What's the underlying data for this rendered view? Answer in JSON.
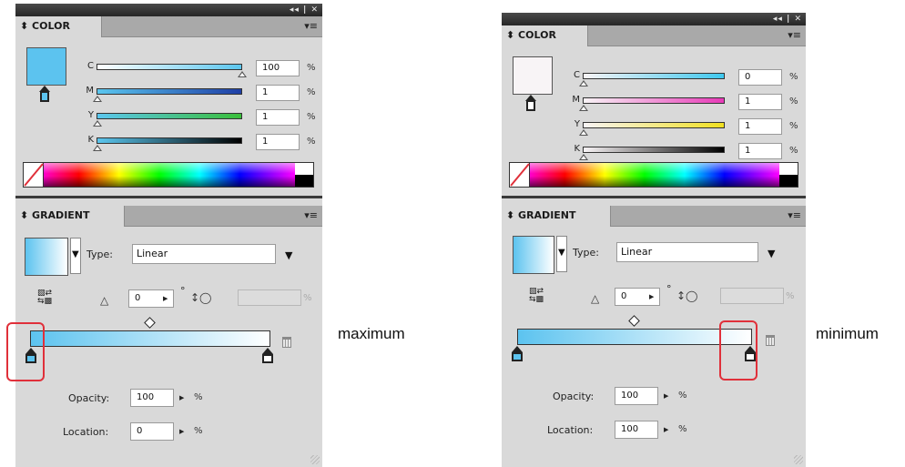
{
  "panels": [
    {
      "id": "left",
      "window_controls": "◂◂ | ✕",
      "color": {
        "tab": "⬍ COLOR",
        "swatch_color": "#5cc3ef",
        "channels": [
          {
            "label": "C",
            "value": "100",
            "unit": "%",
            "level": 1.0,
            "gradient": [
              "#ffffff",
              "#5bc6ee"
            ]
          },
          {
            "label": "M",
            "value": "1",
            "unit": "%",
            "level": 0.01,
            "gradient": [
              "#5bc6ee",
              "#1f3fa6"
            ]
          },
          {
            "label": "Y",
            "value": "1",
            "unit": "%",
            "level": 0.01,
            "gradient": [
              "#5bc6ee",
              "#3abf3a"
            ]
          },
          {
            "label": "K",
            "value": "1",
            "unit": "%",
            "level": 0.01,
            "gradient": [
              "#5bc6ee",
              "#000000"
            ]
          }
        ]
      },
      "gradient": {
        "tab": "⬍ GRADIENT",
        "type_label": "Type:",
        "type_value": "Linear",
        "angle_value": "0",
        "degree_symbol": "°",
        "percent_symbol": "%",
        "opacity_label": "Opacity:",
        "opacity_value": "100",
        "opacity_unit": "%",
        "location_label": "Location:",
        "location_value": "0",
        "location_unit": "%",
        "selected_stop": "left"
      },
      "caption": "maximum"
    },
    {
      "id": "right",
      "window_controls": "◂◂ | ✕",
      "color": {
        "tab": "⬍ COLOR",
        "swatch_color": "#f8f4f6",
        "channels": [
          {
            "label": "C",
            "value": "0",
            "unit": "%",
            "level": 0.0,
            "gradient": [
              "#f8f4f6",
              "#3ec8ee"
            ]
          },
          {
            "label": "M",
            "value": "1",
            "unit": "%",
            "level": 0.01,
            "gradient": [
              "#f8f4f6",
              "#e83ab8"
            ]
          },
          {
            "label": "Y",
            "value": "1",
            "unit": "%",
            "level": 0.01,
            "gradient": [
              "#f8f4f6",
              "#f0e020"
            ]
          },
          {
            "label": "K",
            "value": "1",
            "unit": "%",
            "level": 0.01,
            "gradient": [
              "#f8f4f6",
              "#000000"
            ]
          }
        ]
      },
      "gradient": {
        "tab": "⬍ GRADIENT",
        "type_label": "Type:",
        "type_value": "Linear",
        "angle_value": "0",
        "degree_symbol": "°",
        "percent_symbol": "%",
        "opacity_label": "Opacity:",
        "opacity_value": "100",
        "opacity_unit": "%",
        "location_label": "Location:",
        "location_value": "100",
        "location_unit": "%",
        "selected_stop": "right"
      },
      "caption": "minimum"
    }
  ],
  "colors": {
    "gradient_start": "#5cc3ef",
    "gradient_end": "#ffffff",
    "highlight": "#e0303a",
    "menu_icon": "▾≡"
  }
}
